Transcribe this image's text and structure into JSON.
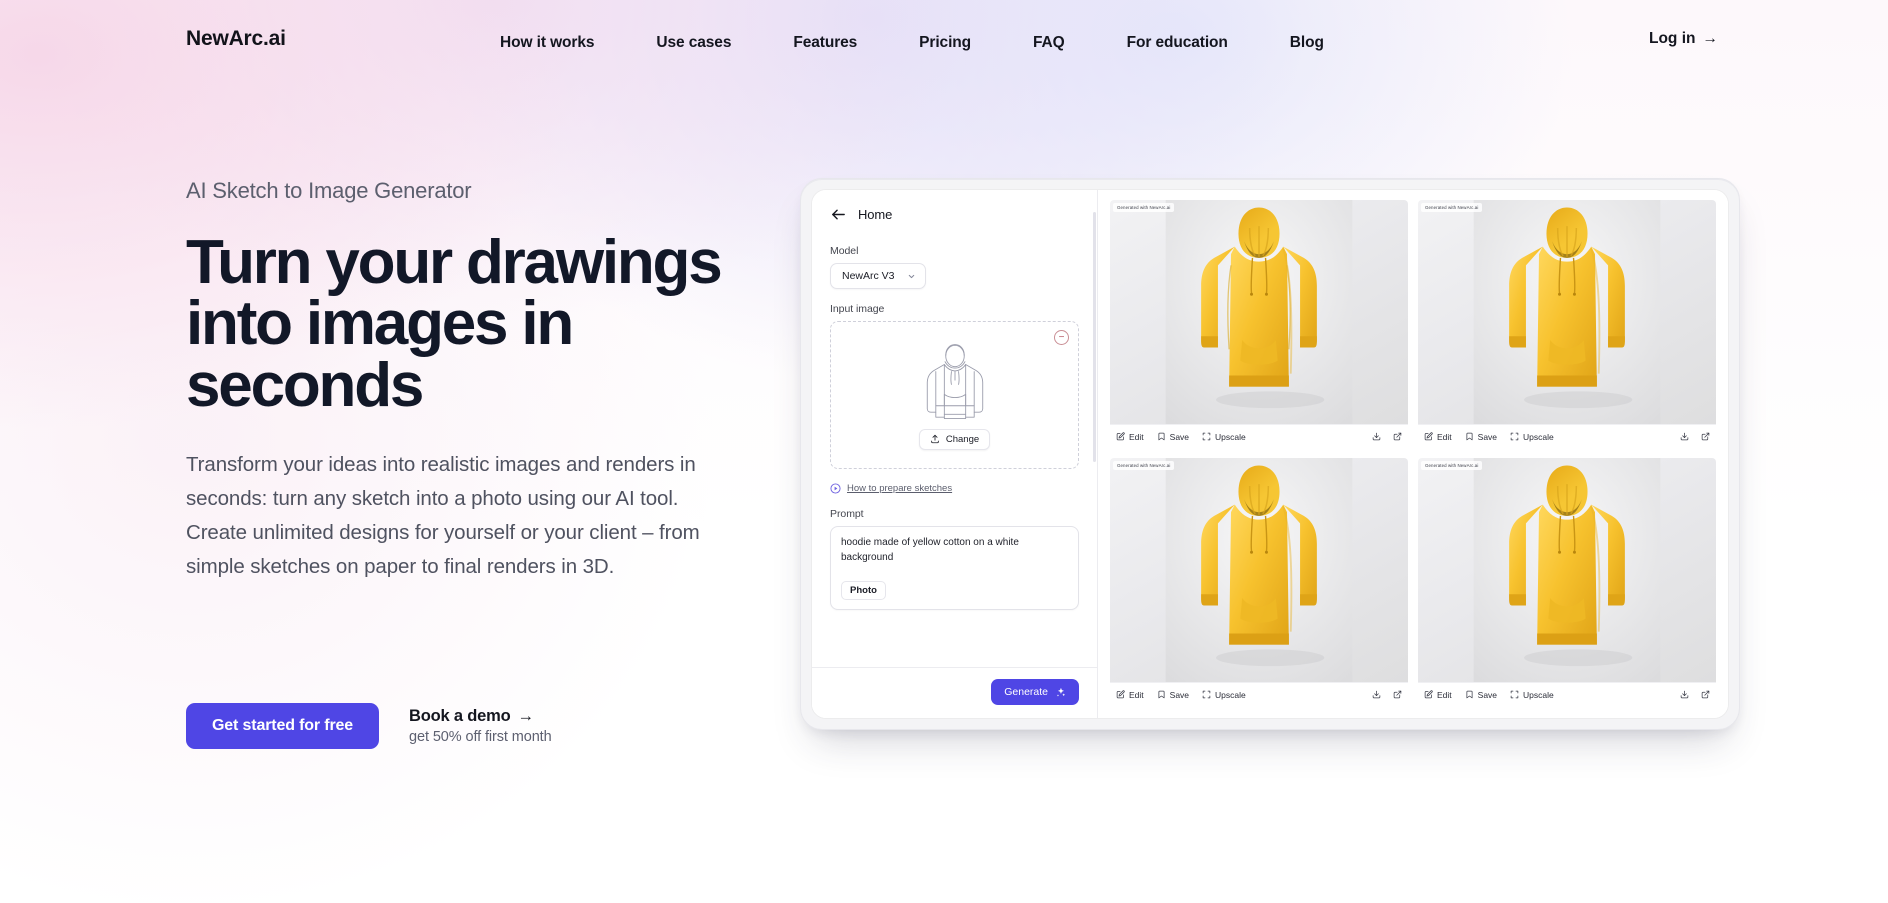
{
  "brand": {
    "name": "NewArc.ai"
  },
  "nav": {
    "links": [
      {
        "label": "How it works"
      },
      {
        "label": "Use cases"
      },
      {
        "label": "Features"
      },
      {
        "label": "Pricing"
      },
      {
        "label": "FAQ"
      },
      {
        "label": "For education"
      },
      {
        "label": "Blog"
      }
    ],
    "login": {
      "label": "Log in",
      "arrow": "→"
    }
  },
  "hero": {
    "eyebrow": "AI Sketch to Image Generator",
    "headline": "Turn your drawings into images in seconds",
    "subcopy": "Transform your ideas into realistic images and renders in seconds: turn any sketch into a photo using our AI tool. Create unlimited designs for yourself or your client – from simple sketches on paper to final renders in 3D.",
    "primary_cta": "Get started for free",
    "demo_cta": "Book a demo",
    "demo_arrow": "→",
    "demo_sub": "get 50% off first month"
  },
  "app": {
    "panel": {
      "title": "Home",
      "model_label": "Model",
      "model_value": "NewArc V3",
      "input_label": "Input image",
      "change_button": "Change",
      "remove_button": "−",
      "help_link": "How to prepare sketches",
      "prompt_label": "Prompt",
      "prompt_value": "hoodie made of yellow cotton on a white background",
      "prompt_tag": "Photo",
      "generate_button": "Generate"
    },
    "card_actions": {
      "edit": "Edit",
      "save": "Save",
      "upscale": "Upscale"
    },
    "watermark": "Generated with NewArc.ai",
    "results": [
      {
        "id": "result-1"
      },
      {
        "id": "result-2"
      },
      {
        "id": "result-3"
      },
      {
        "id": "result-4"
      }
    ]
  },
  "colors": {
    "accent": "#4f46e5",
    "heading": "#121828",
    "body_text": "#4f5260",
    "hoodie": "#f5c236"
  }
}
